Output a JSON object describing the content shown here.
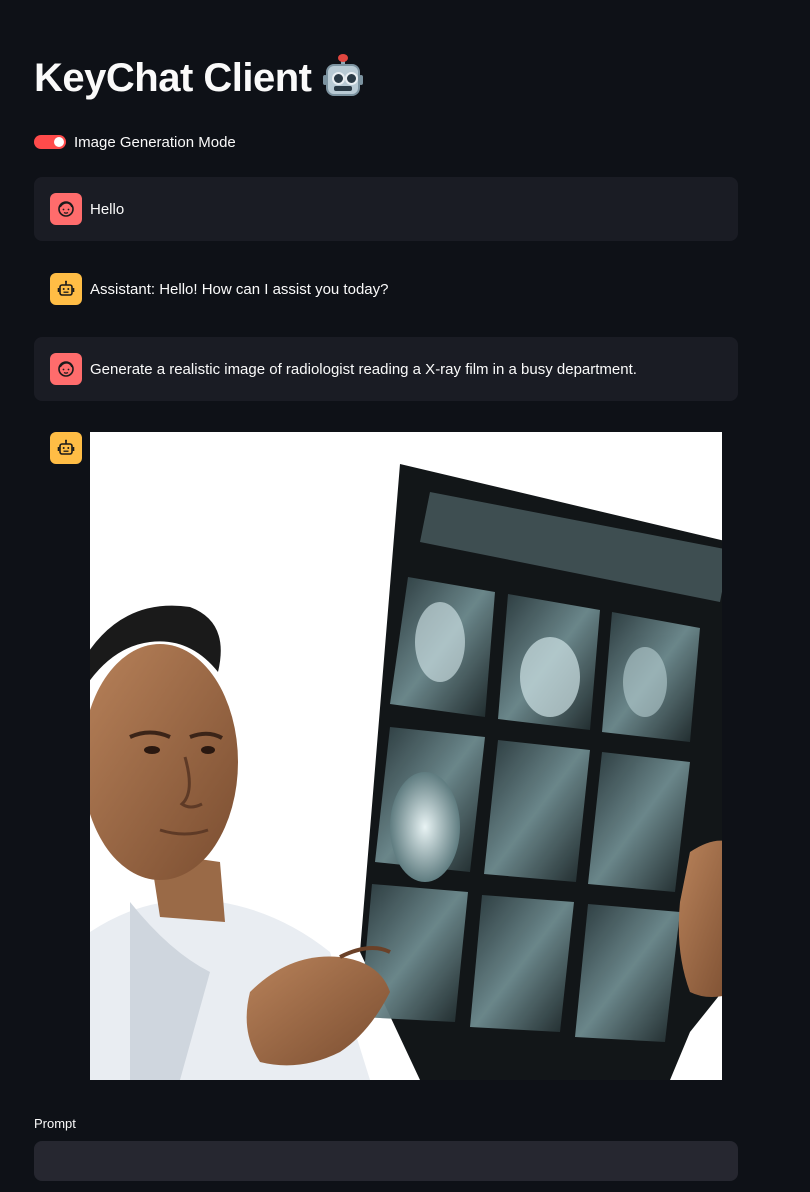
{
  "app": {
    "title": "KeyChat Client",
    "title_icon": "robot-emoji"
  },
  "toggle": {
    "label": "Image Generation Mode",
    "checked": true,
    "accent_color": "#ff4b4b"
  },
  "messages": [
    {
      "role": "user",
      "avatar_icon": "user-face-icon",
      "text": "Hello"
    },
    {
      "role": "assistant",
      "avatar_icon": "robot-icon",
      "text": "Assistant: Hello! How can I assist you today?"
    },
    {
      "role": "user",
      "avatar_icon": "user-face-icon",
      "text": "Generate a realistic image of radiologist reading a X-ray film in a busy department."
    },
    {
      "role": "assistant",
      "avatar_icon": "robot-icon",
      "content_type": "image"
    }
  ],
  "prompt": {
    "label": "Prompt",
    "value": "",
    "placeholder": ""
  },
  "colors": {
    "background": "#0e1117",
    "user_message_bg": "#1a1c24",
    "user_avatar": "#ff6c6c",
    "assistant_avatar": "#ffbd45",
    "input_bg": "#262730"
  }
}
